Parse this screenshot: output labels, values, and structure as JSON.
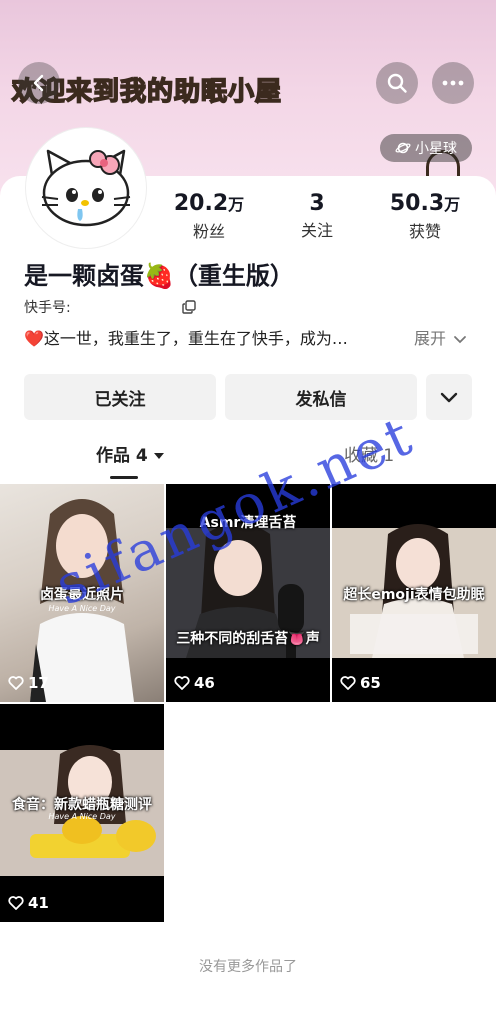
{
  "banner": {
    "title": "欢迎来到我的助眠小屋",
    "planet_label": "小星球"
  },
  "profile": {
    "name": "是一颗卤蛋🍓（重生版）",
    "id_label": "快手号:",
    "bio": "这一世，我重生了，重生在了快手，成为…",
    "bio_heart": "❤️",
    "expand_label": "展开"
  },
  "stats": [
    {
      "num": "20.2",
      "unit": "万",
      "label": "粉丝"
    },
    {
      "num": "3",
      "unit": "",
      "label": "关注"
    },
    {
      "num": "50.3",
      "unit": "万",
      "label": "获赞"
    }
  ],
  "buttons": {
    "followed": "已关注",
    "message": "发私信"
  },
  "tabs": {
    "works": "作品 4",
    "favorites": "收藏 1"
  },
  "posts": [
    {
      "caption": "卤蛋最近照片",
      "sub": "Have A Nice Day",
      "likes": "17"
    },
    {
      "caption_top": "Asmr清理舌苔",
      "caption": "三种不同的刮舌苔👅声",
      "likes": "46"
    },
    {
      "caption": "超长emoji表情包助眠",
      "likes": "65"
    },
    {
      "caption": "食音：新款蜡瓶糖测评",
      "sub": "Have A Nice Day",
      "likes": "41"
    }
  ],
  "footer": {
    "no_more": "没有更多作品了"
  },
  "watermark": "sifangok.net",
  "colors": {
    "banner_pink": "#f3d6e6",
    "heart_red": "#e8353c",
    "watermark_blue": "#283cdc"
  }
}
